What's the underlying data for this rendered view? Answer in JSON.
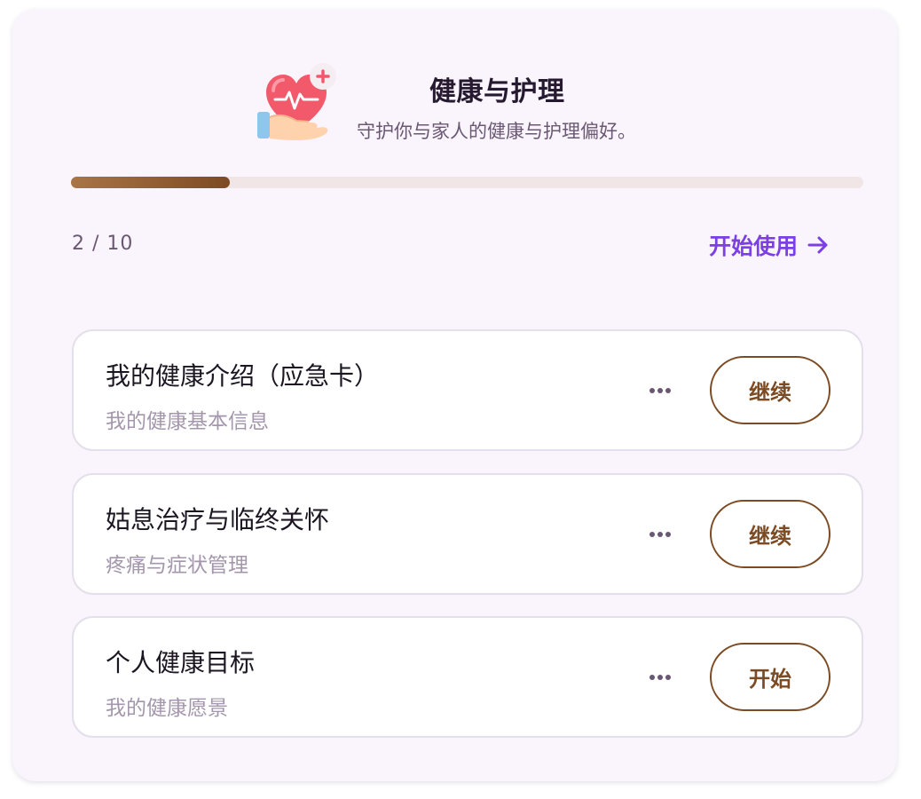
{
  "header": {
    "icon": "heart-care-icon",
    "title": "健康与护理",
    "subtitle": "守护你与家人的健康与护理偏好。"
  },
  "progress": {
    "current": 2,
    "total": 10,
    "fraction": 0.2,
    "label": "2 / 10"
  },
  "start_link": {
    "label": "开始使用",
    "icon": "arrow-right-icon"
  },
  "items": [
    {
      "title": "我的健康介绍（应急卡）",
      "subtitle": "我的健康基本信息",
      "action": "继续",
      "more_icon": "more-dots-icon"
    },
    {
      "title": "姑息治疗与临终关怀",
      "subtitle": "疼痛与症状管理",
      "action": "继续",
      "more_icon": "more-dots-icon"
    },
    {
      "title": "个人健康目标",
      "subtitle": "我的健康愿景",
      "action": "开始",
      "more_icon": "more-dots-icon"
    }
  ],
  "colors": {
    "card_background": "#faf4fd",
    "accent_purple": "#7b3fe4",
    "brown": "#7d4b23",
    "progress_track": "#efe6e5"
  }
}
